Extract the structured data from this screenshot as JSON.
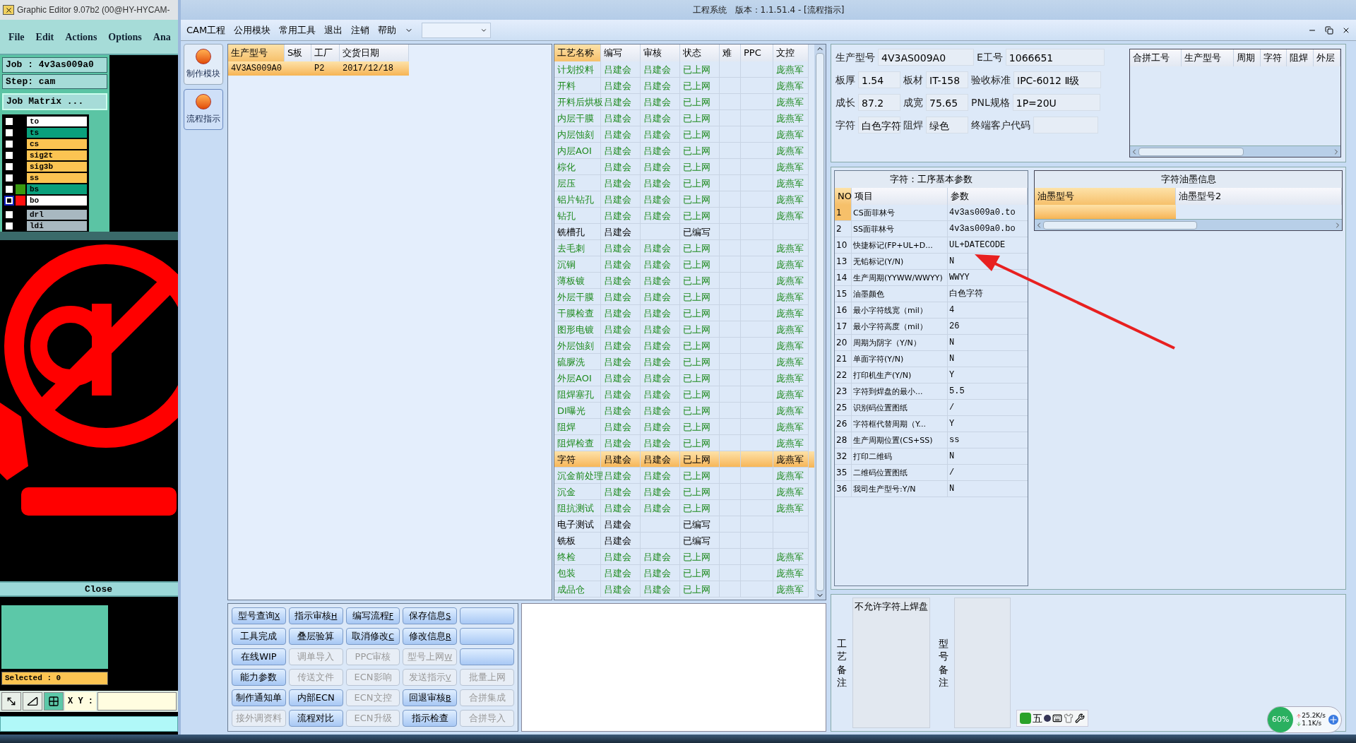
{
  "editor": {
    "title": "Graphic Editor 9.07b2 (00@HY-HYCAM-",
    "menu": [
      "File",
      "Edit",
      "Actions",
      "Options",
      "Ana"
    ],
    "job": "Job : 4v3as009a0",
    "step": "Step: cam",
    "matrix_button": "Job Matrix ...",
    "layers": [
      {
        "name": "to",
        "color": "#ffffff",
        "selected": false
      },
      {
        "name": "ts",
        "color": "#0aa07c",
        "selected": false
      },
      {
        "name": "cs",
        "color": "#fcc452",
        "selected": false
      },
      {
        "name": "sig2t",
        "color": "#fcc452",
        "selected": false
      },
      {
        "name": "sig3b",
        "color": "#fcc452",
        "selected": false
      },
      {
        "name": "ss",
        "color": "#fcc452",
        "selected": false
      },
      {
        "name": "bs",
        "color": "#0aa07c",
        "swatch": {
          "color": "#3a9a10"
        },
        "selected": false
      },
      {
        "name": "bo",
        "color": "#ffffff",
        "swatch": {
          "color": "#ff1010"
        },
        "selected": true
      }
    ],
    "drill_layers": [
      {
        "name": "drl",
        "color": "#a8b8c0",
        "selected": false
      },
      {
        "name": "ldi",
        "color": "#a8b8c0",
        "selected": false
      }
    ],
    "close_button": "Close",
    "selected_count": "Selected : 0",
    "xy_label": "X Y :"
  },
  "window": {
    "title": "工程系统　版本：1.1.51.4 - [流程指示]"
  },
  "menu": [
    "CAM工程",
    "公用模块",
    "常用工具",
    "退出",
    "注销",
    "帮助"
  ],
  "side_buttons": [
    {
      "label": "制作模块",
      "selected": false
    },
    {
      "label": "流程指示",
      "selected": true
    }
  ],
  "jobs": {
    "columns": [
      "生产型号",
      "S板",
      "工厂",
      "交货日期"
    ],
    "rows": [
      {
        "model": "4V3AS009A0",
        "factory": "P2",
        "date": "2017/12/18",
        "selected": true
      }
    ]
  },
  "process": {
    "columns": [
      "工艺名称",
      "编写",
      "审核",
      "状态",
      "难",
      "PPC",
      "文控"
    ],
    "rows": [
      {
        "name": "计划投料",
        "writer": "吕建会",
        "reviewer": "吕建会",
        "status": "已上网",
        "control": "庞燕军",
        "published": true,
        "selected": false
      },
      {
        "name": "开料",
        "writer": "吕建会",
        "reviewer": "吕建会",
        "status": "已上网",
        "control": "庞燕军",
        "published": true,
        "selected": false
      },
      {
        "name": "开料后烘板",
        "writer": "吕建会",
        "reviewer": "吕建会",
        "status": "已上网",
        "control": "庞燕军",
        "published": true,
        "selected": false
      },
      {
        "name": "内层干膜",
        "writer": "吕建会",
        "reviewer": "吕建会",
        "status": "已上网",
        "control": "庞燕军",
        "published": true,
        "selected": false
      },
      {
        "name": "内层蚀刻",
        "writer": "吕建会",
        "reviewer": "吕建会",
        "status": "已上网",
        "control": "庞燕军",
        "published": true,
        "selected": false
      },
      {
        "name": "内层AOI",
        "writer": "吕建会",
        "reviewer": "吕建会",
        "status": "已上网",
        "control": "庞燕军",
        "published": true,
        "selected": false
      },
      {
        "name": "棕化",
        "writer": "吕建会",
        "reviewer": "吕建会",
        "status": "已上网",
        "control": "庞燕军",
        "published": true,
        "selected": false
      },
      {
        "name": "层压",
        "writer": "吕建会",
        "reviewer": "吕建会",
        "status": "已上网",
        "control": "庞燕军",
        "published": true,
        "selected": false
      },
      {
        "name": "铝片钻孔",
        "writer": "吕建会",
        "reviewer": "吕建会",
        "status": "已上网",
        "control": "庞燕军",
        "published": true,
        "selected": false
      },
      {
        "name": "钻孔",
        "writer": "吕建会",
        "reviewer": "吕建会",
        "status": "已上网",
        "control": "庞燕军",
        "published": true,
        "selected": false
      },
      {
        "name": "铣槽孔",
        "writer": "吕建会",
        "status": "已编写",
        "published": false,
        "selected": false
      },
      {
        "name": "去毛刺",
        "writer": "吕建会",
        "reviewer": "吕建会",
        "status": "已上网",
        "control": "庞燕军",
        "published": true,
        "selected": false
      },
      {
        "name": "沉铜",
        "writer": "吕建会",
        "reviewer": "吕建会",
        "status": "已上网",
        "control": "庞燕军",
        "published": true,
        "selected": false
      },
      {
        "name": "薄板镀",
        "writer": "吕建会",
        "reviewer": "吕建会",
        "status": "已上网",
        "control": "庞燕军",
        "published": true,
        "selected": false
      },
      {
        "name": "外层干膜",
        "writer": "吕建会",
        "reviewer": "吕建会",
        "status": "已上网",
        "control": "庞燕军",
        "published": true,
        "selected": false
      },
      {
        "name": "干膜检查",
        "writer": "吕建会",
        "reviewer": "吕建会",
        "status": "已上网",
        "control": "庞燕军",
        "published": true,
        "selected": false
      },
      {
        "name": "图形电镀",
        "writer": "吕建会",
        "reviewer": "吕建会",
        "status": "已上网",
        "control": "庞燕军",
        "published": true,
        "selected": false
      },
      {
        "name": "外层蚀刻",
        "writer": "吕建会",
        "reviewer": "吕建会",
        "status": "已上网",
        "control": "庞燕军",
        "published": true,
        "selected": false
      },
      {
        "name": "硫脲洗",
        "writer": "吕建会",
        "reviewer": "吕建会",
        "status": "已上网",
        "control": "庞燕军",
        "published": true,
        "selected": false
      },
      {
        "name": "外层AOI",
        "writer": "吕建会",
        "reviewer": "吕建会",
        "status": "已上网",
        "control": "庞燕军",
        "published": true,
        "selected": false
      },
      {
        "name": "阻焊塞孔",
        "writer": "吕建会",
        "reviewer": "吕建会",
        "status": "已上网",
        "control": "庞燕军",
        "published": true,
        "selected": false
      },
      {
        "name": "DI曝光",
        "writer": "吕建会",
        "reviewer": "吕建会",
        "status": "已上网",
        "control": "庞燕军",
        "published": true,
        "selected": false
      },
      {
        "name": "阻焊",
        "writer": "吕建会",
        "reviewer": "吕建会",
        "status": "已上网",
        "control": "庞燕军",
        "published": true,
        "selected": false
      },
      {
        "name": "阻焊检查",
        "writer": "吕建会",
        "reviewer": "吕建会",
        "status": "已上网",
        "control": "庞燕军",
        "published": true,
        "selected": false
      },
      {
        "name": "字符",
        "writer": "吕建会",
        "reviewer": "吕建会",
        "status": "已上网",
        "control": "庞燕军",
        "published": true,
        "selected": true
      },
      {
        "name": "沉金前处理",
        "writer": "吕建会",
        "reviewer": "吕建会",
        "status": "已上网",
        "control": "庞燕军",
        "published": true,
        "selected": false
      },
      {
        "name": "沉金",
        "writer": "吕建会",
        "reviewer": "吕建会",
        "status": "已上网",
        "control": "庞燕军",
        "published": true,
        "selected": false
      },
      {
        "name": "阻抗测试",
        "writer": "吕建会",
        "reviewer": "吕建会",
        "status": "已上网",
        "control": "庞燕军",
        "published": true,
        "selected": false
      },
      {
        "name": "电子测试",
        "writer": "吕建会",
        "status": "已编写",
        "published": false,
        "selected": false
      },
      {
        "name": "铣板",
        "writer": "吕建会",
        "status": "已编写",
        "published": false,
        "selected": false
      },
      {
        "name": "终检",
        "writer": "吕建会",
        "reviewer": "吕建会",
        "status": "已上网",
        "control": "庞燕军",
        "published": true,
        "selected": false
      },
      {
        "name": "包装",
        "writer": "吕建会",
        "reviewer": "吕建会",
        "status": "已上网",
        "control": "庞燕军",
        "published": true,
        "selected": false
      },
      {
        "name": "成品仓",
        "writer": "吕建会",
        "reviewer": "吕建会",
        "status": "已上网",
        "control": "庞燕军",
        "published": true,
        "selected": false
      }
    ]
  },
  "info": [
    [
      {
        "label": "生产型号",
        "value": "4V3AS009A0"
      },
      {
        "label": "E工号",
        "value": "1066651"
      }
    ],
    [
      {
        "label": "板厚",
        "value": "1.54"
      },
      {
        "label": "板材",
        "value": "IT-158"
      },
      {
        "label": "验收标准",
        "value": "IPC-6012 Ⅱ级"
      }
    ],
    [
      {
        "label": "成长",
        "value": "87.2"
      },
      {
        "label": "成宽",
        "value": "75.65"
      },
      {
        "label": "PNL规格",
        "value": "1P=20U"
      }
    ],
    [
      {
        "label": "字符",
        "value": "白色字符"
      },
      {
        "label": "阻焊",
        "value": "绿色"
      },
      {
        "label": "终端客户代码"
      }
    ]
  ],
  "merge_table": {
    "columns": [
      "合拼工号",
      "生产型号",
      "周期",
      "字符",
      "阻焊",
      "外层"
    ]
  },
  "params": {
    "title": "字符：工序基本参数",
    "columns": [
      "NO",
      "项目",
      "参数"
    ],
    "rows": [
      {
        "no": "1",
        "item": "CS面菲林号",
        "value": "4v3as009a0.to"
      },
      {
        "no": "2",
        "item": "SS面菲林号",
        "value": "4v3as009a0.bo"
      },
      {
        "no": "10",
        "item": "快捷标记(FP+UL+D...",
        "value": "UL+DATECODE"
      },
      {
        "no": "13",
        "item": "无铅标记(Y/N)",
        "value": "N"
      },
      {
        "no": "14",
        "item": "生产周期(YYWW/WWYY)",
        "value": "WWYY"
      },
      {
        "no": "15",
        "item": "油墨颜色",
        "value": "白色字符"
      },
      {
        "no": "16",
        "item": "最小字符线宽（mil）",
        "value": "4"
      },
      {
        "no": "17",
        "item": "最小字符高度（mil）",
        "value": "26"
      },
      {
        "no": "20",
        "item": "周期为阴字（Y/N）",
        "value": "N"
      },
      {
        "no": "21",
        "item": "单面字符(Y/N)",
        "value": "N"
      },
      {
        "no": "22",
        "item": "打印机生产(Y/N)",
        "value": "Y"
      },
      {
        "no": "23",
        "item": "字符到焊盘的最小...",
        "value": "5.5"
      },
      {
        "no": "25",
        "item": "识别码位置图纸",
        "value": "/"
      },
      {
        "no": "26",
        "item": "字符框代替周期（Y...",
        "value": "Y"
      },
      {
        "no": "28",
        "item": "生产周期位置(CS+SS)",
        "value": "ss"
      },
      {
        "no": "32",
        "item": "打印二维码",
        "value": "N"
      },
      {
        "no": "35",
        "item": "二维码位置图纸",
        "value": "/"
      },
      {
        "no": "36",
        "item": "我司生产型号:Y/N",
        "value": "N"
      }
    ]
  },
  "ink": {
    "title": "字符油墨信息",
    "columns": [
      "油墨型号",
      "油墨型号2"
    ]
  },
  "buttons": [
    {
      "label": "型号查询",
      "key": "X",
      "disabled": false
    },
    {
      "label": "指示审核",
      "key": "H",
      "disabled": false
    },
    {
      "label": "编写流程",
      "key": "F",
      "disabled": false
    },
    {
      "label": "保存信息",
      "key": "S",
      "disabled": false
    },
    {
      "disabled": false
    },
    {
      "label": "工具完成",
      "disabled": false
    },
    {
      "label": "叠层验算",
      "disabled": false
    },
    {
      "label": "取消修改",
      "key": "C",
      "disabled": false
    },
    {
      "label": "修改信息",
      "key": "R",
      "disabled": false
    },
    {
      "disabled": false
    },
    {
      "label": "在线WIP",
      "disabled": false
    },
    {
      "label": "调单导入",
      "disabled": true
    },
    {
      "label": "PPC审核",
      "disabled": true
    },
    {
      "label": "型号上网",
      "key": "W",
      "disabled": true
    },
    {
      "disabled": false
    },
    {
      "label": "能力参数",
      "disabled": false
    },
    {
      "label": "传送文件",
      "disabled": true
    },
    {
      "label": "ECN影响",
      "disabled": true
    },
    {
      "label": "发送指示",
      "key": "V",
      "disabled": true
    },
    {
      "label": "批量上网",
      "disabled": true
    },
    {
      "label": "制作通知单",
      "disabled": false
    },
    {
      "label": "内部ECN",
      "disabled": false
    },
    {
      "label": "ECN文控",
      "disabled": true
    },
    {
      "label": "回退审核",
      "key": "B",
      "disabled": false
    },
    {
      "label": "合拼集成",
      "disabled": true
    },
    {
      "label": "接外调资料",
      "disabled": true
    },
    {
      "label": "流程对比",
      "disabled": false
    },
    {
      "label": "ECN升级",
      "disabled": true
    },
    {
      "label": "指示检查",
      "disabled": false
    },
    {
      "label": "合拼导入",
      "disabled": true
    }
  ],
  "notes": [
    {
      "label": "工艺备注",
      "value": "不允许字符上焊盘"
    },
    {
      "label": "型号备注"
    }
  ],
  "ime": {
    "label": "五"
  },
  "tray": {
    "percent": "60%",
    "up": "25.2K/s",
    "down": "1.1K/s"
  }
}
